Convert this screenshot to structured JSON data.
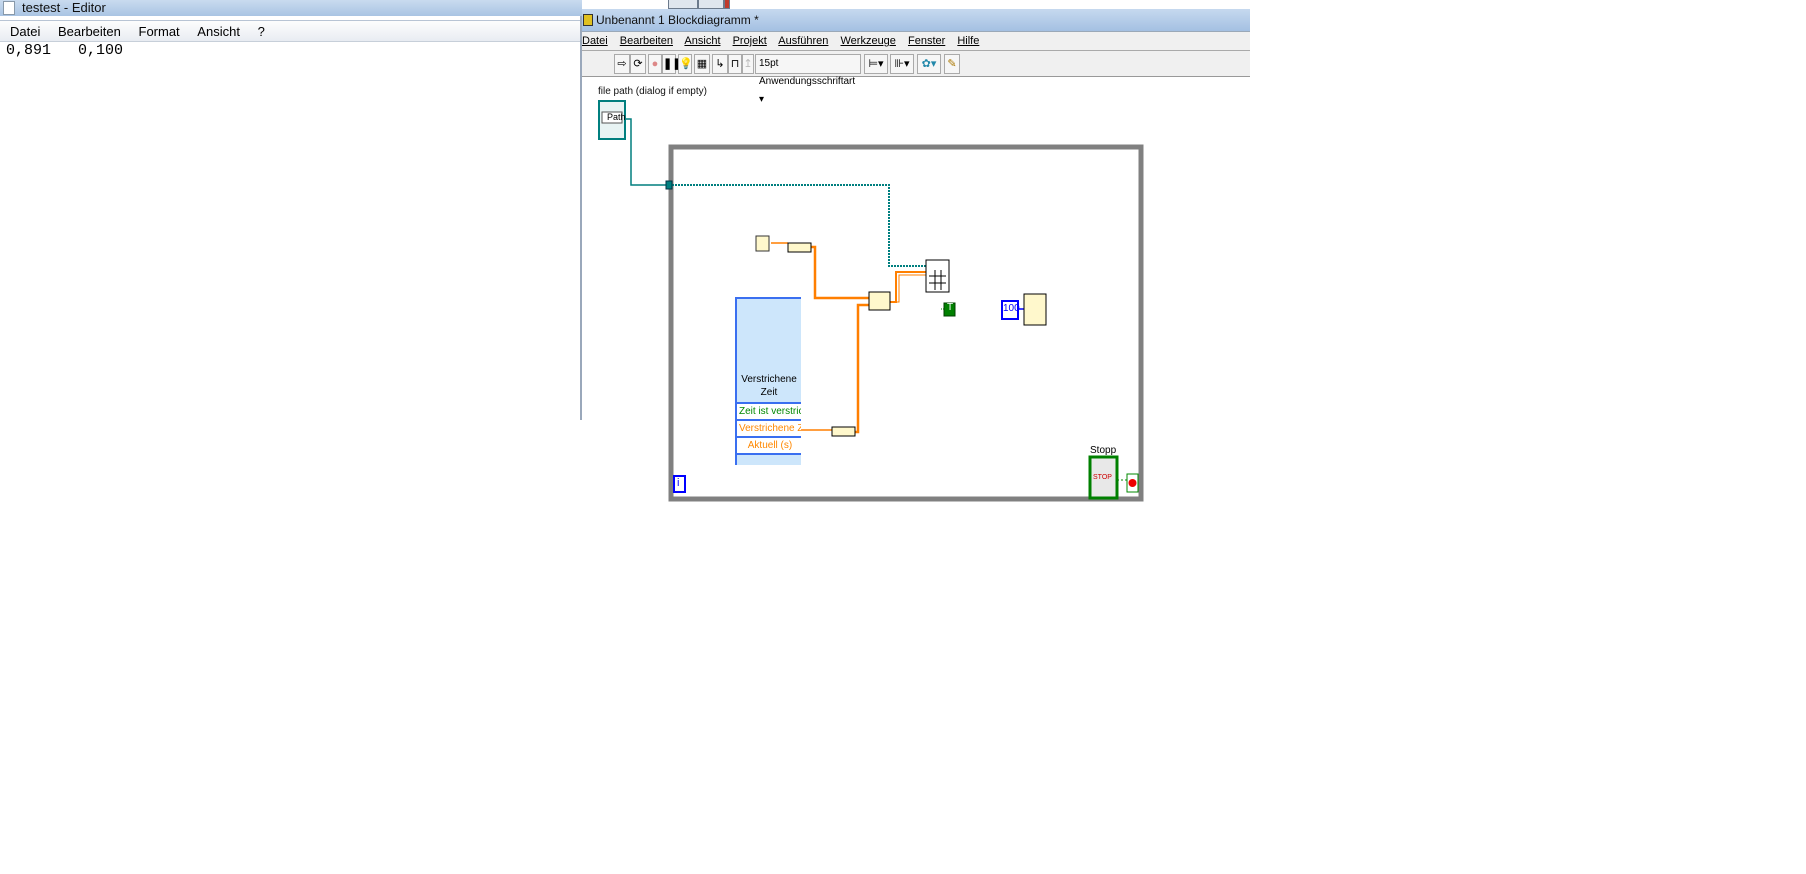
{
  "notepad": {
    "title": "testest - Editor",
    "menu": [
      "Datei",
      "Bearbeiten",
      "Format",
      "Ansicht",
      "?"
    ],
    "content": "0,891   0,100"
  },
  "labview": {
    "title": "Unbenannt 1 Blockdiagramm *",
    "menu": [
      "Datei",
      "Bearbeiten",
      "Ansicht",
      "Projekt",
      "Ausführen",
      "Werkzeuge",
      "Fenster",
      "Hilfe"
    ],
    "toolbar": {
      "font": "15pt Anwendungsschriftart"
    },
    "diagram": {
      "path_label": "file path (dialog if empty)",
      "path_text": "Path",
      "elapsed_title": "Verstrichene Zeit",
      "elapsed_rows": [
        "Zeit ist verstrichen",
        "Verstrichene Zeit",
        "Aktuell (s)"
      ],
      "true_const": "T",
      "wait_const": "100",
      "stop_label": "Stopp",
      "stop_text": "STOP",
      "iter_label": "i"
    }
  },
  "colors": {
    "wire_orange": "#ff7f00",
    "wire_path": "#007f7f",
    "loop": "#808080",
    "bool": "#008000"
  }
}
